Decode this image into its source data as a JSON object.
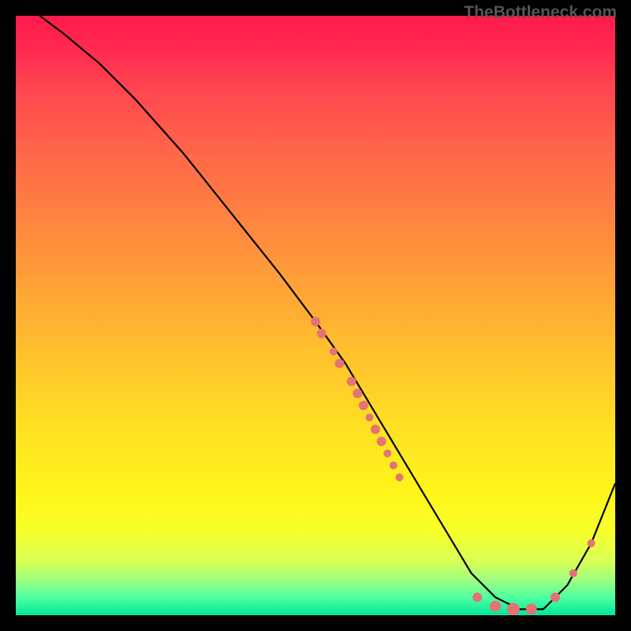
{
  "watermark": "TheBottleneck.com",
  "chart_data": {
    "type": "line",
    "title": "",
    "xlabel": "",
    "ylabel": "",
    "xlim": [
      0,
      100
    ],
    "ylim": [
      0,
      100
    ],
    "series": [
      {
        "name": "curve",
        "x": [
          4,
          8,
          14,
          20,
          28,
          36,
          44,
          50,
          55,
          58,
          61,
          64,
          67,
          70,
          73,
          76,
          80,
          84,
          88,
          92,
          96,
          100
        ],
        "y": [
          100,
          97,
          92,
          86,
          77,
          67,
          57,
          49,
          42,
          37,
          32,
          27,
          22,
          17,
          12,
          7,
          3,
          1,
          1,
          5,
          12,
          22
        ]
      }
    ],
    "markers": [
      {
        "x": 50,
        "y": 49,
        "r": 6
      },
      {
        "x": 51,
        "y": 47,
        "r": 6
      },
      {
        "x": 53,
        "y": 44,
        "r": 5
      },
      {
        "x": 54,
        "y": 42,
        "r": 6
      },
      {
        "x": 56,
        "y": 39,
        "r": 6
      },
      {
        "x": 57,
        "y": 37,
        "r": 6
      },
      {
        "x": 58,
        "y": 35,
        "r": 6
      },
      {
        "x": 59,
        "y": 33,
        "r": 5
      },
      {
        "x": 60,
        "y": 31,
        "r": 6
      },
      {
        "x": 61,
        "y": 29,
        "r": 6
      },
      {
        "x": 62,
        "y": 27,
        "r": 5
      },
      {
        "x": 63,
        "y": 25,
        "r": 5
      },
      {
        "x": 64,
        "y": 23,
        "r": 5
      },
      {
        "x": 77,
        "y": 3,
        "r": 6
      },
      {
        "x": 80,
        "y": 1.5,
        "r": 7
      },
      {
        "x": 83,
        "y": 1,
        "r": 8
      },
      {
        "x": 86,
        "y": 1,
        "r": 7
      },
      {
        "x": 90,
        "y": 3,
        "r": 6
      },
      {
        "x": 93,
        "y": 7,
        "r": 5
      },
      {
        "x": 96,
        "y": 12,
        "r": 5
      }
    ],
    "marker_color": "#e57373",
    "curve_color": "#000000"
  }
}
